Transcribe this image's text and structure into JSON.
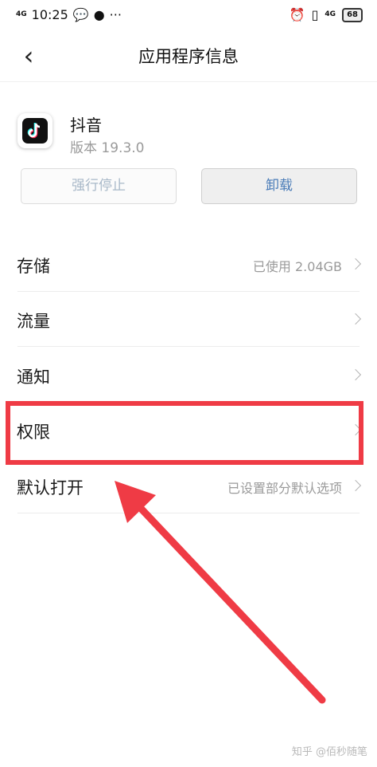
{
  "status_bar": {
    "time": "10:25",
    "network_left": "4G",
    "network_right": "4G",
    "battery": "68"
  },
  "nav": {
    "title": "应用程序信息"
  },
  "app": {
    "name": "抖音",
    "version": "版本 19.3.0"
  },
  "buttons": {
    "force_stop": "强行停止",
    "uninstall": "卸载"
  },
  "settings": [
    {
      "label": "存储",
      "value": "已使用 2.04GB"
    },
    {
      "label": "流量",
      "value": ""
    },
    {
      "label": "通知",
      "value": ""
    },
    {
      "label": "权限",
      "value": ""
    },
    {
      "label": "默认打开",
      "value": "已设置部分默认选项"
    }
  ],
  "annotation": {
    "highlight_color": "#ef3b45",
    "arrow_color": "#ef3b45"
  },
  "watermark": "知乎 @佰秒随笔"
}
